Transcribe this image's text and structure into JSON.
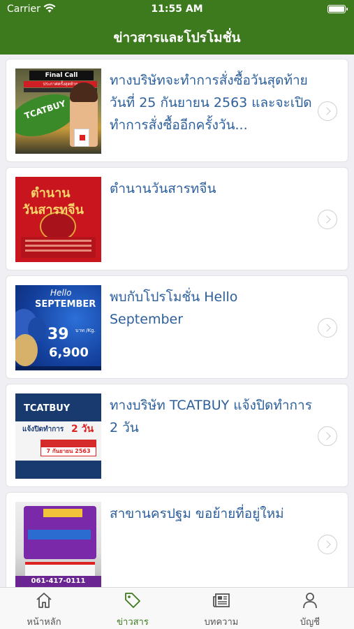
{
  "status_bar": {
    "carrier": "Carrier",
    "time": "11:55 AM"
  },
  "header": {
    "title": "ข่าวสารและโปรโมชั่น"
  },
  "news": [
    {
      "title": "ทางบริษัทจะทำการสั่งซื้อวันสุดท้ายวันที่ 25 กันยายน 2563 และจะเปิดทำการสั่งซื้ออีกครั้งวัน...",
      "image_text": [
        "Final Call",
        "ประกาศครั้งสุดท้าย",
        "TCATBUY"
      ]
    },
    {
      "title": "ตำนานวันสารทจีน",
      "image_text": [
        "ตำนาน",
        "วันสารทจีน"
      ]
    },
    {
      "title": "พบกับโปรโมชั่น Hello September",
      "image_text": [
        "Hello",
        "SEPTEMBER",
        "39",
        "บาท /Kg.",
        "6,900"
      ]
    },
    {
      "title": "ทางบริษัท TCATBUY แจ้งปิดทำการ 2 วัน",
      "image_text": [
        "TCATBUY",
        "แจ้งปิดทำการ",
        "2 วัน",
        "7 กันยายน 2563"
      ]
    },
    {
      "title": "สาขานครปฐม ขอย้ายที่อยู่ใหม่",
      "image_text": [
        "061-417-0111"
      ]
    }
  ],
  "tabs": [
    {
      "label": "หน้าหลัก",
      "icon": "home-icon",
      "active": false
    },
    {
      "label": "ข่าวสาร",
      "icon": "tag-icon",
      "active": true
    },
    {
      "label": "บทความ",
      "icon": "newspaper-icon",
      "active": false
    },
    {
      "label": "บัญชี",
      "icon": "person-icon",
      "active": false
    }
  ],
  "colors": {
    "primary": "#3d7a1e",
    "title_text": "#2c5f9c",
    "background": "#efeff4"
  }
}
